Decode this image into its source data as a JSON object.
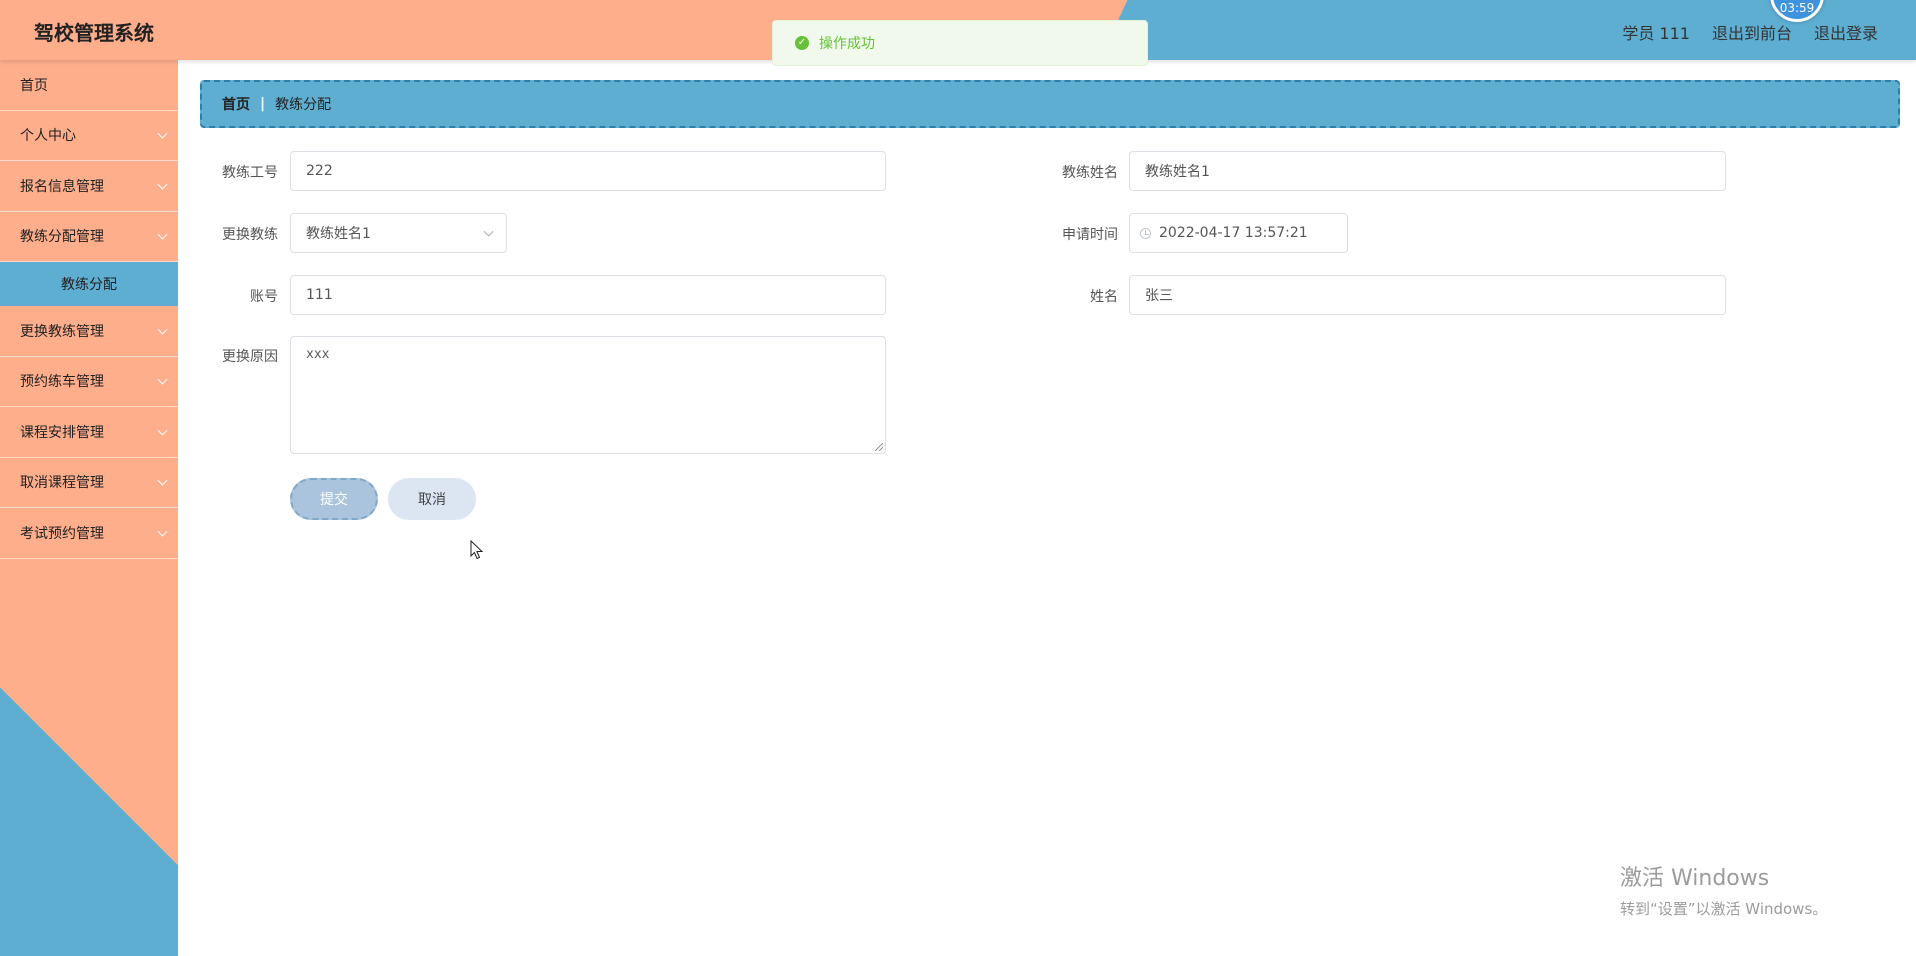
{
  "header": {
    "title": "驾校管理系统",
    "user_label": "学员 111",
    "front_label": "退出到前台",
    "logout_label": "退出登录",
    "clock": "03:59"
  },
  "toast": {
    "message": "操作成功"
  },
  "sidebar": {
    "items": [
      {
        "label": "首页"
      },
      {
        "label": "个人中心"
      },
      {
        "label": "报名信息管理"
      },
      {
        "label": "教练分配管理"
      },
      {
        "label": "教练分配"
      },
      {
        "label": "更换教练管理"
      },
      {
        "label": "预约练车管理"
      },
      {
        "label": "课程安排管理"
      },
      {
        "label": "取消课程管理"
      },
      {
        "label": "考试预约管理"
      }
    ]
  },
  "breadcrumb": {
    "home": "首页",
    "current": "教练分配"
  },
  "form": {
    "coach_id_label": "教练工号",
    "coach_id_value": "222",
    "coach_name_label": "教练姓名",
    "coach_name_value": "教练姓名1",
    "change_coach_label": "更换教练",
    "change_coach_value": "教练姓名1",
    "apply_time_label": "申请时间",
    "apply_time_value": "2022-04-17 13:57:21",
    "account_label": "账号",
    "account_value": "111",
    "name_label": "姓名",
    "name_value": "张三",
    "reason_label": "更换原因",
    "reason_value": "xxx",
    "submit_label": "提交",
    "cancel_label": "取消"
  },
  "watermark": {
    "line1": "激活 Windows",
    "line2": "转到“设置”以激活 Windows。"
  },
  "colors": {
    "peach": "#ffae8c",
    "blue": "#5eaed2",
    "success": "#67c23a"
  }
}
